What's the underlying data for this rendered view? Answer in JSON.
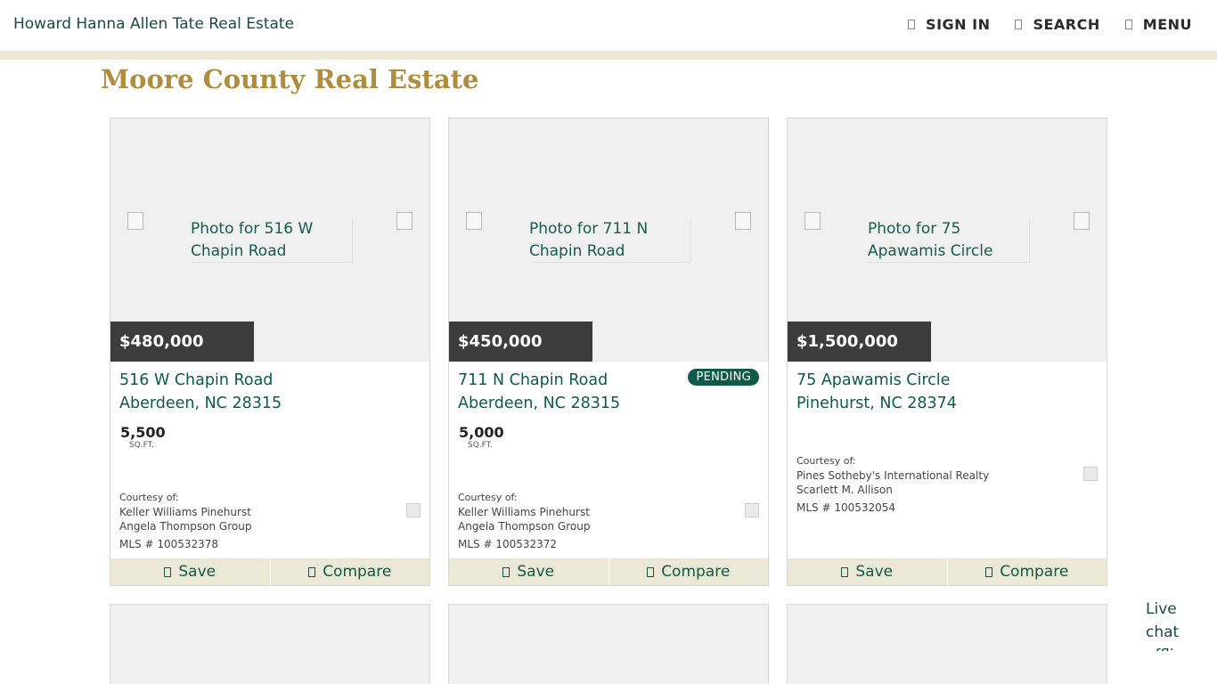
{
  "header": {
    "logo_alt": "Howard Hanna Allen Tate Real Estate",
    "nav": [
      {
        "label": "SIGN IN",
        "icon": "user-icon"
      },
      {
        "label": "SEARCH",
        "icon": "search-icon"
      },
      {
        "label": "MENU",
        "icon": "menu-icon"
      }
    ]
  },
  "page_title": "Moore County Real Estate",
  "listings": [
    {
      "photo_alt": "Photo for 516 W Chapin Road",
      "price": "$480,000",
      "street": "516 W Chapin Road",
      "city": "Aberdeen, NC 28315",
      "badge": "",
      "sqft": "5,500",
      "sqft_label": "SQ.FT.",
      "courtesy_label": "Courtesy of:",
      "office": "Keller Williams Pinehurst",
      "agent": "Angela Thompson Group",
      "mls": "MLS # 100532378",
      "save": "Save",
      "compare": "Compare"
    },
    {
      "photo_alt": "Photo for 711 N Chapin Road",
      "price": "$450,000",
      "street": "711 N Chapin Road",
      "city": "Aberdeen, NC 28315",
      "badge": "PENDING",
      "sqft": "5,000",
      "sqft_label": "SQ.FT.",
      "courtesy_label": "Courtesy of:",
      "office": "Keller Williams Pinehurst",
      "agent": "Angela Thompson Group",
      "mls": "MLS # 100532372",
      "save": "Save",
      "compare": "Compare"
    },
    {
      "photo_alt": "Photo for 75 Apawamis Circle",
      "price": "$1,500,000",
      "street": "75 Apawamis Circle",
      "city": "Pinehurst, NC 28374",
      "badge": "",
      "sqft": "",
      "sqft_label": "",
      "courtesy_label": "Courtesy of:",
      "office": "Pines Sotheby's International Realty",
      "agent": "Scarlett M. Allison",
      "mls": "MLS # 100532054",
      "save": "Save",
      "compare": "Compare"
    }
  ],
  "livechat_alt": "Live chat offline",
  "colors": {
    "brand_green": "#0f5a48",
    "title_gold": "#b08d3c",
    "stripe": "#ece8d6",
    "price_bg": "#3c3c3c"
  }
}
